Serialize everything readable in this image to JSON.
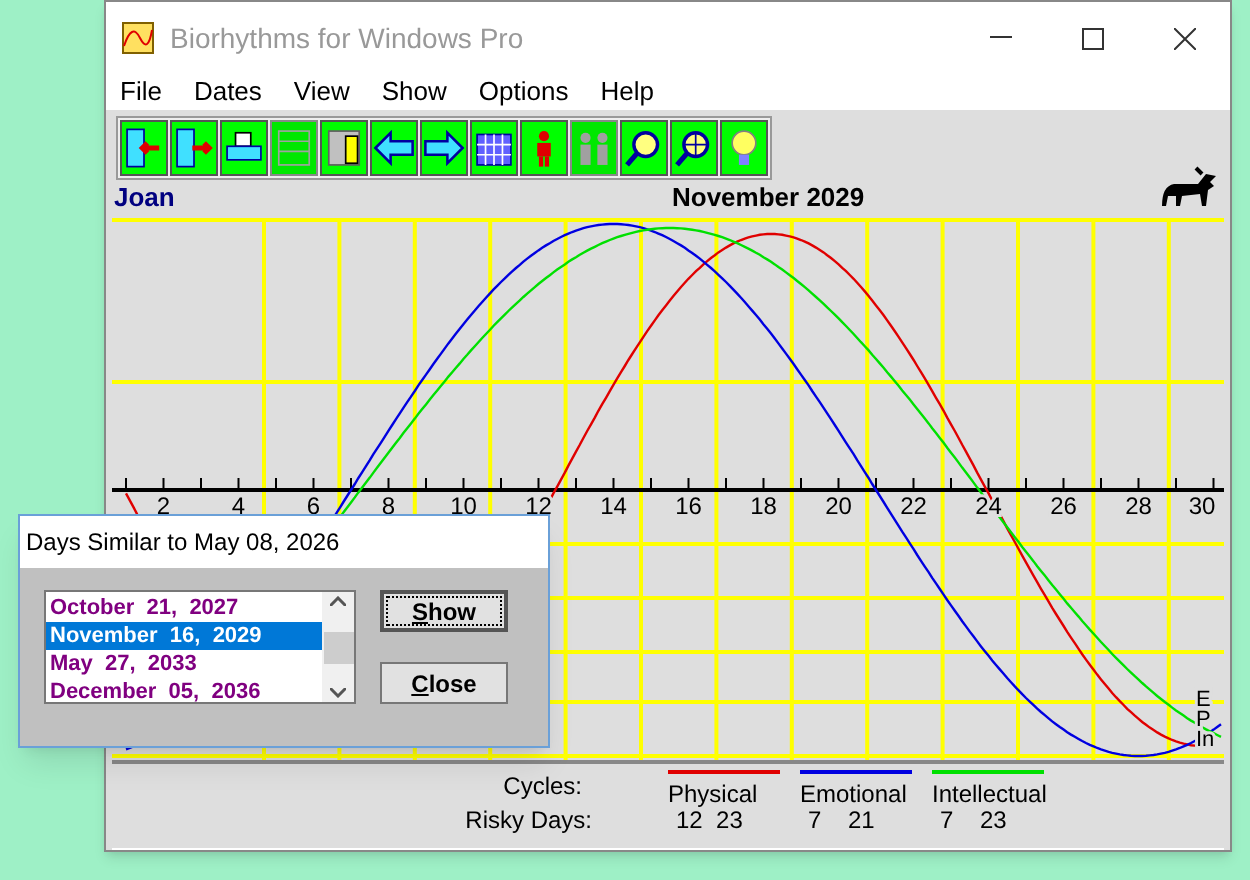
{
  "window": {
    "title": "Biorhythms for Windows Pro"
  },
  "menu": [
    "File",
    "Dates",
    "View",
    "Show",
    "Options",
    "Help"
  ],
  "toolbar": [
    {
      "kind": "door-left",
      "disabled": false
    },
    {
      "kind": "door-right",
      "disabled": false
    },
    {
      "kind": "printer",
      "disabled": false
    },
    {
      "kind": "list",
      "disabled": true
    },
    {
      "kind": "document",
      "disabled": false
    },
    {
      "kind": "arrow-left",
      "disabled": false
    },
    {
      "kind": "arrow-right",
      "disabled": false
    },
    {
      "kind": "calendar",
      "disabled": false
    },
    {
      "kind": "person",
      "disabled": false
    },
    {
      "kind": "people",
      "disabled": true
    },
    {
      "kind": "magnifier",
      "disabled": false
    },
    {
      "kind": "globe",
      "disabled": false
    },
    {
      "kind": "bulb",
      "disabled": false
    }
  ],
  "chart": {
    "person": "Joan",
    "month": "November 2029",
    "day_labels": [
      "2",
      "4",
      "6",
      "8",
      "10",
      "12",
      "14",
      "16",
      "18",
      "20",
      "22",
      "24",
      "26",
      "28",
      "30"
    ],
    "curve_labels": [
      "E",
      "P",
      "In"
    ]
  },
  "legend": {
    "cycles_label": "Cycles:",
    "risky_label": "Risky Days:",
    "cycles": [
      {
        "name": "Physical",
        "color": "#e00000",
        "risky": "12  23"
      },
      {
        "name": "Emotional",
        "color": "#0000e0",
        "risky": "7    21"
      },
      {
        "name": "Intellectual",
        "color": "#00e000",
        "risky": "7    23"
      }
    ]
  },
  "dialog": {
    "title": "Days Similar to May 08, 2026",
    "items": [
      {
        "label": "October  21,  2027",
        "selected": false
      },
      {
        "label": "November  16,  2029",
        "selected": true
      },
      {
        "label": "May  27,  2033",
        "selected": false
      },
      {
        "label": "December  05,  2036",
        "selected": false
      }
    ],
    "buttons": [
      {
        "label": "Show",
        "focused": true
      },
      {
        "label": "Close",
        "focused": false
      }
    ]
  }
}
